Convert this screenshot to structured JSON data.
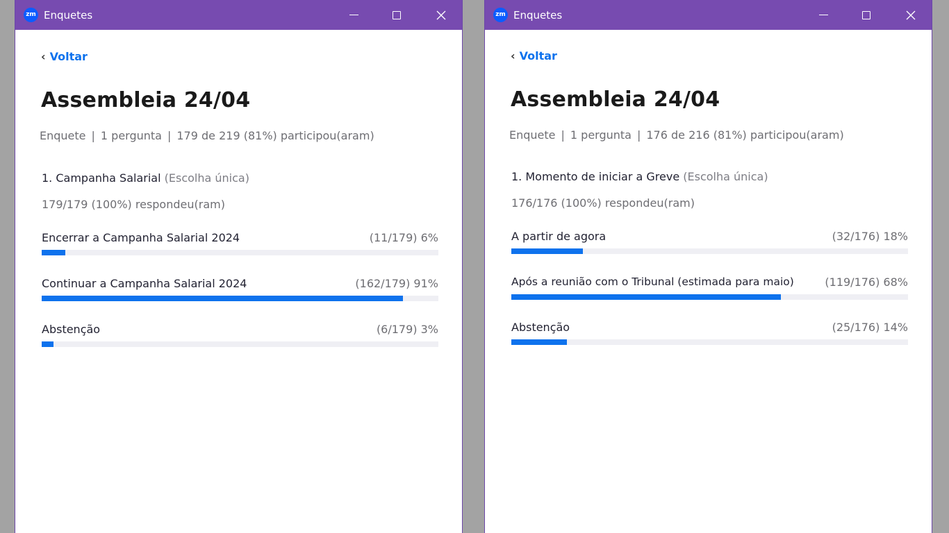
{
  "windows": [
    {
      "app_title": "Enquetes",
      "logo_text": "zm",
      "back_label": "Voltar",
      "poll_title": "Assembleia 24/04",
      "meta": {
        "type": "Enquete",
        "questions": "1 pergunta",
        "participation": "179 de 219 (81%) participou(aram)"
      },
      "question": {
        "text": "1. Campanha Salarial",
        "type_label": "(Escolha única)",
        "answered": "179/179 (100%) respondeu(ram)"
      },
      "options": [
        {
          "label": "Encerrar a Campanha Salarial 2024",
          "result": "(11/179) 6%",
          "fraction": 0.06
        },
        {
          "label": "Continuar a Campanha Salarial 2024",
          "result": "(162/179) 91%",
          "fraction": 0.91
        },
        {
          "label": "Abstenção",
          "result": "(6/179) 3%",
          "fraction": 0.03
        }
      ],
      "colors": {
        "titlebar": "#774bb0",
        "accent": "#0e72ed"
      },
      "icons": [
        "chevron-left-icon",
        "minimize-icon",
        "maximize-icon",
        "close-icon"
      ]
    },
    {
      "app_title": "Enquetes",
      "logo_text": "zm",
      "back_label": "Voltar",
      "poll_title": "Assembleia 24/04",
      "meta": {
        "type": "Enquete",
        "questions": "1 pergunta",
        "participation": "176 de 216 (81%) participou(aram)"
      },
      "question": {
        "text": "1. Momento de iniciar a Greve",
        "type_label": "(Escolha única)",
        "answered": "176/176 (100%) respondeu(ram)"
      },
      "options": [
        {
          "label": "A partir de agora",
          "result": "(32/176) 18%",
          "fraction": 0.18
        },
        {
          "label": "Após a reunião com o Tribunal (estimada para maio)",
          "result": "(119/176) 68%",
          "fraction": 0.68
        },
        {
          "label": "Abstenção",
          "result": "(25/176) 14%",
          "fraction": 0.14
        }
      ],
      "colors": {
        "titlebar": "#774bb0",
        "accent": "#0e72ed"
      },
      "icons": [
        "chevron-left-icon",
        "minimize-icon",
        "maximize-icon",
        "close-icon"
      ]
    }
  ]
}
